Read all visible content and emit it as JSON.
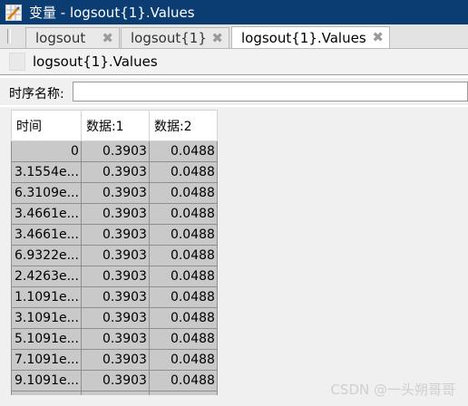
{
  "window": {
    "title": "变量 - logsout{1}.Values",
    "icon": "variable-editor-icon"
  },
  "tabs": [
    {
      "label": "logsout",
      "close": "✖"
    },
    {
      "label": "logsout{1}",
      "close": "✖"
    },
    {
      "label": "logsout{1}.Values",
      "close": "✖"
    }
  ],
  "variable": {
    "name": "logsout{1}.Values"
  },
  "timeseries": {
    "label": "时序名称:",
    "value": ""
  },
  "table": {
    "columns": [
      "时间",
      "数据:1",
      "数据:2"
    ],
    "rows": [
      [
        "0",
        "0.3903",
        "0.0488"
      ],
      [
        "3.1554e...",
        "0.3903",
        "0.0488"
      ],
      [
        "6.3109e...",
        "0.3903",
        "0.0488"
      ],
      [
        "3.4661e...",
        "0.3903",
        "0.0488"
      ],
      [
        "3.4661e...",
        "0.3903",
        "0.0488"
      ],
      [
        "6.9322e...",
        "0.3903",
        "0.0488"
      ],
      [
        "2.4263e...",
        "0.3903",
        "0.0488"
      ],
      [
        "1.1091e...",
        "0.3903",
        "0.0488"
      ],
      [
        "3.1091e...",
        "0.3903",
        "0.0488"
      ],
      [
        "5.1091e...",
        "0.3903",
        "0.0488"
      ],
      [
        "7.1091e...",
        "0.3903",
        "0.0488"
      ],
      [
        "9.1091e...",
        "0.3903",
        "0.0488"
      ]
    ]
  },
  "watermark": "CSDN @一头朔哥哥",
  "colors": {
    "titlebar": "#0b3c72",
    "cell_fill": "#c9c9c9",
    "tab_active": "#ffffff"
  }
}
